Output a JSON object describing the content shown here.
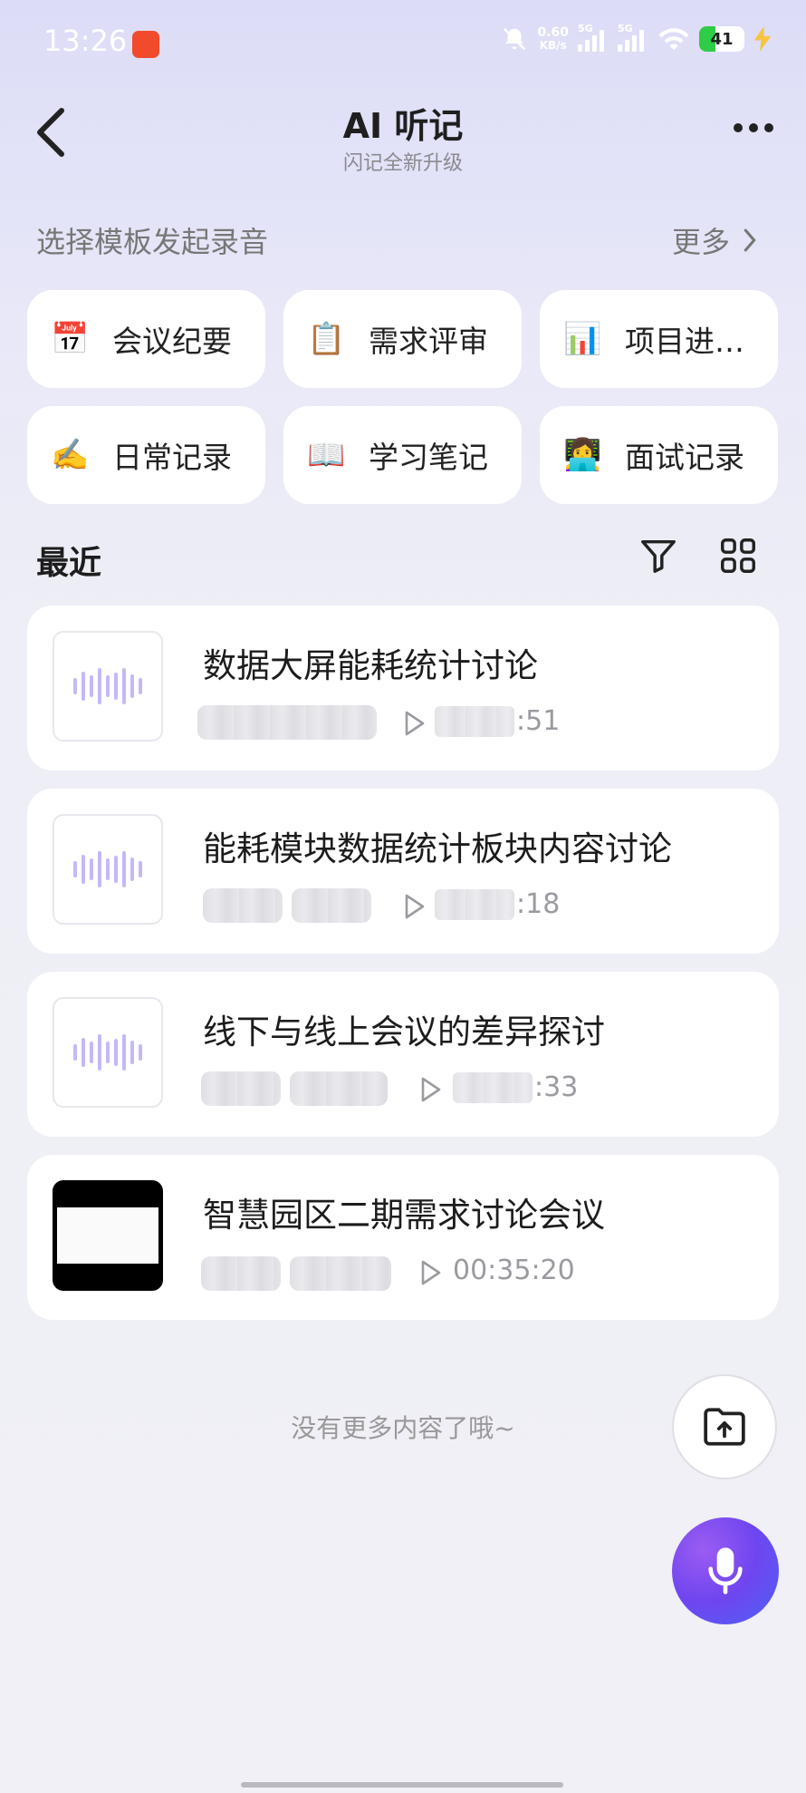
{
  "status_bar": {
    "time": "13:26",
    "net_speed_value": "0.60",
    "net_speed_unit": "KB/s",
    "signal1_label": "5G",
    "signal2_label": "5G",
    "battery": "41"
  },
  "header": {
    "title": "AI 听记",
    "subtitle": "闪记全新升级"
  },
  "templates": {
    "label": "选择模板发起录音",
    "more_label": "更多",
    "items": [
      {
        "icon": "📅",
        "label": "会议纪要"
      },
      {
        "icon": "📋",
        "label": "需求评审"
      },
      {
        "icon": "📊",
        "label": "项目进…"
      },
      {
        "icon": "✍️",
        "label": "日常记录"
      },
      {
        "icon": "📖",
        "label": "学习笔记"
      },
      {
        "icon": "👩‍💻",
        "label": "面试记录"
      }
    ]
  },
  "recent": {
    "label": "最近",
    "items": [
      {
        "title": "数据大屏能耗统计讨论",
        "duration_suffix": ":51"
      },
      {
        "title": "能耗模块数据统计板块内容讨论",
        "duration_suffix": ":18"
      },
      {
        "title": "线下与线上会议的差异探讨",
        "duration_suffix": ":33"
      },
      {
        "title": "智慧园区二期需求讨论会议",
        "duration": "00:35:20"
      }
    ]
  },
  "footer_text": "没有更多内容了哦~",
  "colors": {
    "accent_purple": "#7a4ff1",
    "wave": "#c6b8f5"
  }
}
